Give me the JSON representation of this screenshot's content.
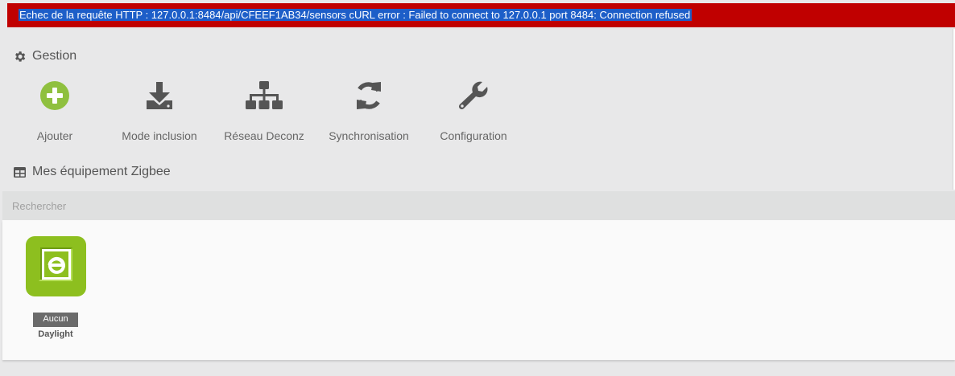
{
  "alert": {
    "message": "Echec de la requête HTTP : 127.0.0.1:8484/api/CFEEF1AB34/sensors cURL error : Failed to connect to 127.0.0.1 port 8484: Connection refused"
  },
  "gestion": {
    "title": "Gestion",
    "icon": "gear-icon",
    "actions": [
      {
        "label": "Ajouter",
        "icon": "plus-circle-icon",
        "color": "#8fc03f"
      },
      {
        "label": "Mode inclusion",
        "icon": "download-icon",
        "color": "#555555"
      },
      {
        "label": "Réseau Deconz",
        "icon": "sitemap-icon",
        "color": "#555555"
      },
      {
        "label": "Synchronisation",
        "icon": "refresh-icon",
        "color": "#555555"
      },
      {
        "label": "Configuration",
        "icon": "wrench-icon",
        "color": "#555555"
      }
    ]
  },
  "equipements": {
    "title": "Mes équipement Zigbee",
    "icon": "table-icon",
    "search_placeholder": "Rechercher",
    "devices": [
      {
        "badge": "Aucun",
        "name": "Daylight",
        "logo_color": "#8dbf1f"
      }
    ]
  },
  "colors": {
    "alert_bg": "#c00000",
    "selection": "#1d5ec8",
    "accent_green": "#8fc03f"
  }
}
